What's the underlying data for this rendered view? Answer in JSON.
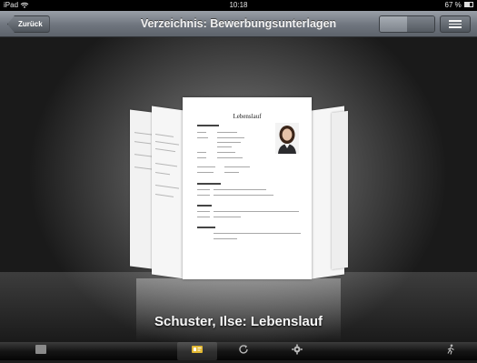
{
  "status_bar": {
    "device": "iPad",
    "time": "10:18",
    "battery": "67 %"
  },
  "nav_bar": {
    "back_label": "Zurück",
    "title": "Verzeichnis: Bewerbungsunterlagen",
    "segment_options": [
      "",
      ""
    ],
    "selected_segment": 0
  },
  "document": {
    "caption": "Schuster, Ilse: Lebenslauf",
    "page_heading": "Lebenslauf"
  },
  "tab_bar": {
    "items": [
      {
        "icon": "document-icon",
        "label": ""
      },
      {
        "icon": "contact-card-icon",
        "label": ""
      },
      {
        "icon": "sync-icon",
        "label": ""
      },
      {
        "icon": "settings-gear-icon",
        "label": ""
      },
      {
        "icon": "exit-icon",
        "label": ""
      }
    ],
    "selected_index": 1
  },
  "colors": {
    "nav_bar": "#6f757e",
    "tab_bar": "#0d0d0d",
    "stage_center": "#8a8a8a",
    "stage_edge": "#1a1a1a"
  }
}
